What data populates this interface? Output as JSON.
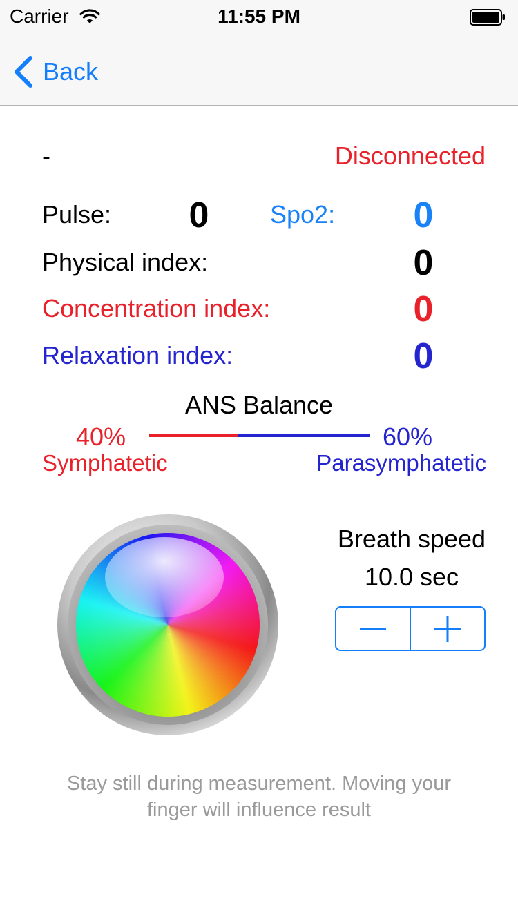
{
  "status_bar": {
    "carrier": "Carrier",
    "time": "11:55 PM",
    "wifi_icon": "wifi-icon",
    "battery_icon": "battery-icon"
  },
  "nav": {
    "back_label": "Back",
    "back_icon": "chevron-left-icon"
  },
  "device": {
    "name": "-",
    "connection_status": "Disconnected"
  },
  "metrics": {
    "pulse_label": "Pulse:",
    "pulse_value": "0",
    "spo2_label": "Spo2:",
    "spo2_value": "0",
    "physical_label": "Physical index:",
    "physical_value": "0",
    "concentration_label": "Concentration index:",
    "concentration_value": "0",
    "relaxation_label": "Relaxation index:",
    "relaxation_value": "0"
  },
  "ans_balance": {
    "title": "ANS Balance",
    "sympathetic_percent": "40%",
    "sympathetic_label": "Symphatetic",
    "parasympathetic_percent": "60%",
    "parasympathetic_label": "Parasymphatetic",
    "sympathetic_fraction": 0.4
  },
  "breath": {
    "title": "Breath speed",
    "value": "10.0 sec",
    "decrease_icon": "minus-icon",
    "increase_icon": "plus-icon"
  },
  "hint": {
    "line1": "Stay still during measurement. Moving your",
    "line2": "finger will influence result"
  },
  "colors": {
    "accent": "#157efb",
    "red": "#e8212a",
    "blue": "#2525cf",
    "light_blue": "#1a82f7",
    "hint_gray": "#9a9a9a"
  }
}
